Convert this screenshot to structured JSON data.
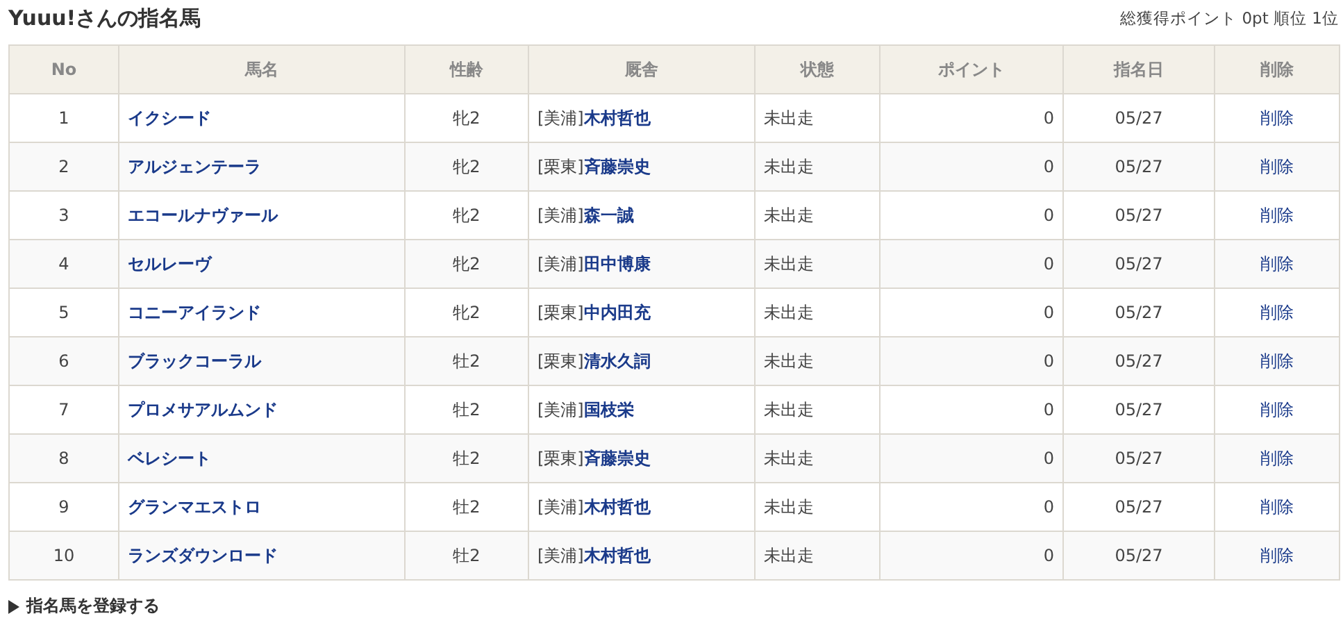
{
  "title": "Yuuu!さんの指名馬",
  "summary": "総獲得ポイント 0pt 順位 1位",
  "table": {
    "columns": [
      "No",
      "馬名",
      "性齢",
      "厩舎",
      "状態",
      "ポイント",
      "指名日",
      "削除"
    ],
    "rows": [
      {
        "no": "1",
        "horse": "イクシード",
        "sex_age": "牝2",
        "region": "[美浦]",
        "trainer": "木村哲也",
        "status": "未出走",
        "points": "0",
        "date": "05/27",
        "action": "削除"
      },
      {
        "no": "2",
        "horse": "アルジェンテーラ",
        "sex_age": "牝2",
        "region": "[栗東]",
        "trainer": "斉藤崇史",
        "status": "未出走",
        "points": "0",
        "date": "05/27",
        "action": "削除"
      },
      {
        "no": "3",
        "horse": "エコールナヴァール",
        "sex_age": "牝2",
        "region": "[美浦]",
        "trainer": "森一誠",
        "status": "未出走",
        "points": "0",
        "date": "05/27",
        "action": "削除"
      },
      {
        "no": "4",
        "horse": "セルレーヴ",
        "sex_age": "牝2",
        "region": "[美浦]",
        "trainer": "田中博康",
        "status": "未出走",
        "points": "0",
        "date": "05/27",
        "action": "削除"
      },
      {
        "no": "5",
        "horse": "コニーアイランド",
        "sex_age": "牝2",
        "region": "[栗東]",
        "trainer": "中内田充",
        "status": "未出走",
        "points": "0",
        "date": "05/27",
        "action": "削除"
      },
      {
        "no": "6",
        "horse": "ブラックコーラル",
        "sex_age": "牡2",
        "region": "[栗東]",
        "trainer": "清水久詞",
        "status": "未出走",
        "points": "0",
        "date": "05/27",
        "action": "削除"
      },
      {
        "no": "7",
        "horse": "プロメサアルムンド",
        "sex_age": "牡2",
        "region": "[美浦]",
        "trainer": "国枝栄",
        "status": "未出走",
        "points": "0",
        "date": "05/27",
        "action": "削除"
      },
      {
        "no": "8",
        "horse": "ベレシート",
        "sex_age": "牡2",
        "region": "[栗東]",
        "trainer": "斉藤崇史",
        "status": "未出走",
        "points": "0",
        "date": "05/27",
        "action": "削除"
      },
      {
        "no": "9",
        "horse": "グランマエストロ",
        "sex_age": "牡2",
        "region": "[美浦]",
        "trainer": "木村哲也",
        "status": "未出走",
        "points": "0",
        "date": "05/27",
        "action": "削除"
      },
      {
        "no": "10",
        "horse": "ランズダウンロード",
        "sex_age": "牡2",
        "region": "[美浦]",
        "trainer": "木村哲也",
        "status": "未出走",
        "points": "0",
        "date": "05/27",
        "action": "削除"
      }
    ]
  },
  "register_link": "指名馬を登録する"
}
